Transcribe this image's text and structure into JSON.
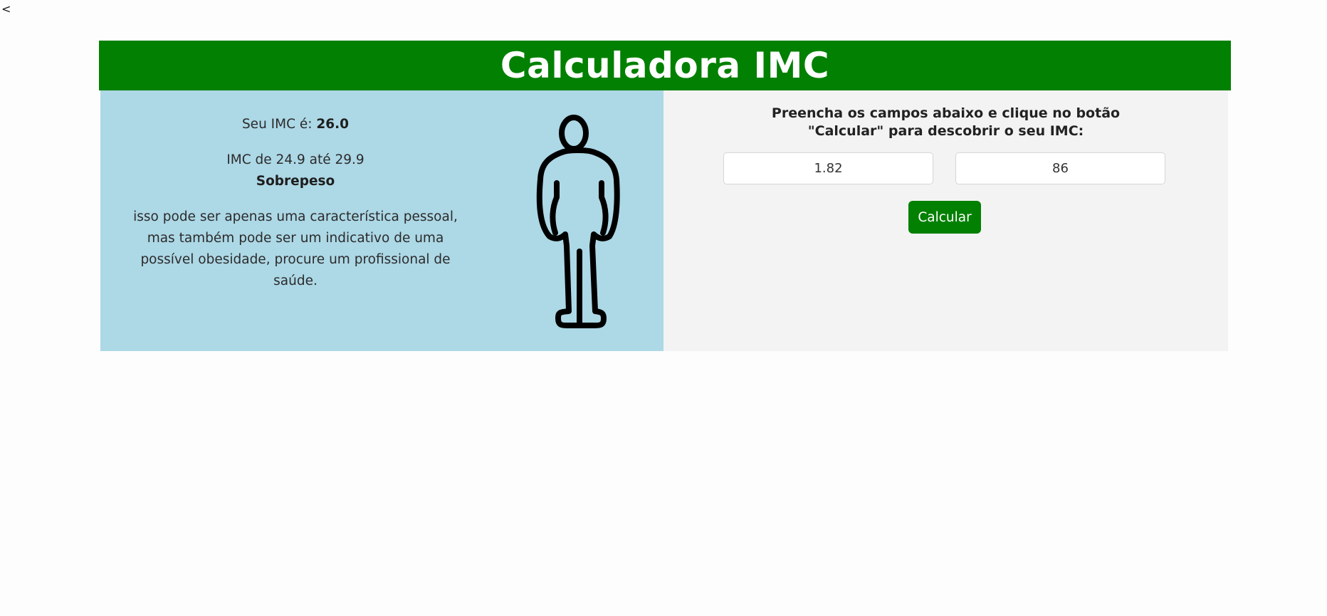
{
  "nav": {
    "back_label": "<"
  },
  "header": {
    "title": "Calculadora IMC"
  },
  "result": {
    "score_prefix": "Seu IMC é: ",
    "score_value": "26.0",
    "range_text": "IMC de 24.9 até 29.9",
    "category": "Sobrepeso",
    "description": "isso pode ser apenas uma característica pessoal, mas também pode ser um indicativo de uma possível obesidade, procure um profissional de saúde.",
    "figure_icon": "person-overweight-icon"
  },
  "form": {
    "instructions_line1": "Preencha os campos abaixo e clique no botão",
    "instructions_line2": "\"Calcular\" para descobrir o seu IMC:",
    "height_value": "1.82",
    "weight_value": "86",
    "button_label": "Calcular"
  },
  "colors": {
    "header_bg": "#028002",
    "result_bg": "#add8e6",
    "form_bg": "#f3f3f3",
    "button_bg": "#028002"
  }
}
